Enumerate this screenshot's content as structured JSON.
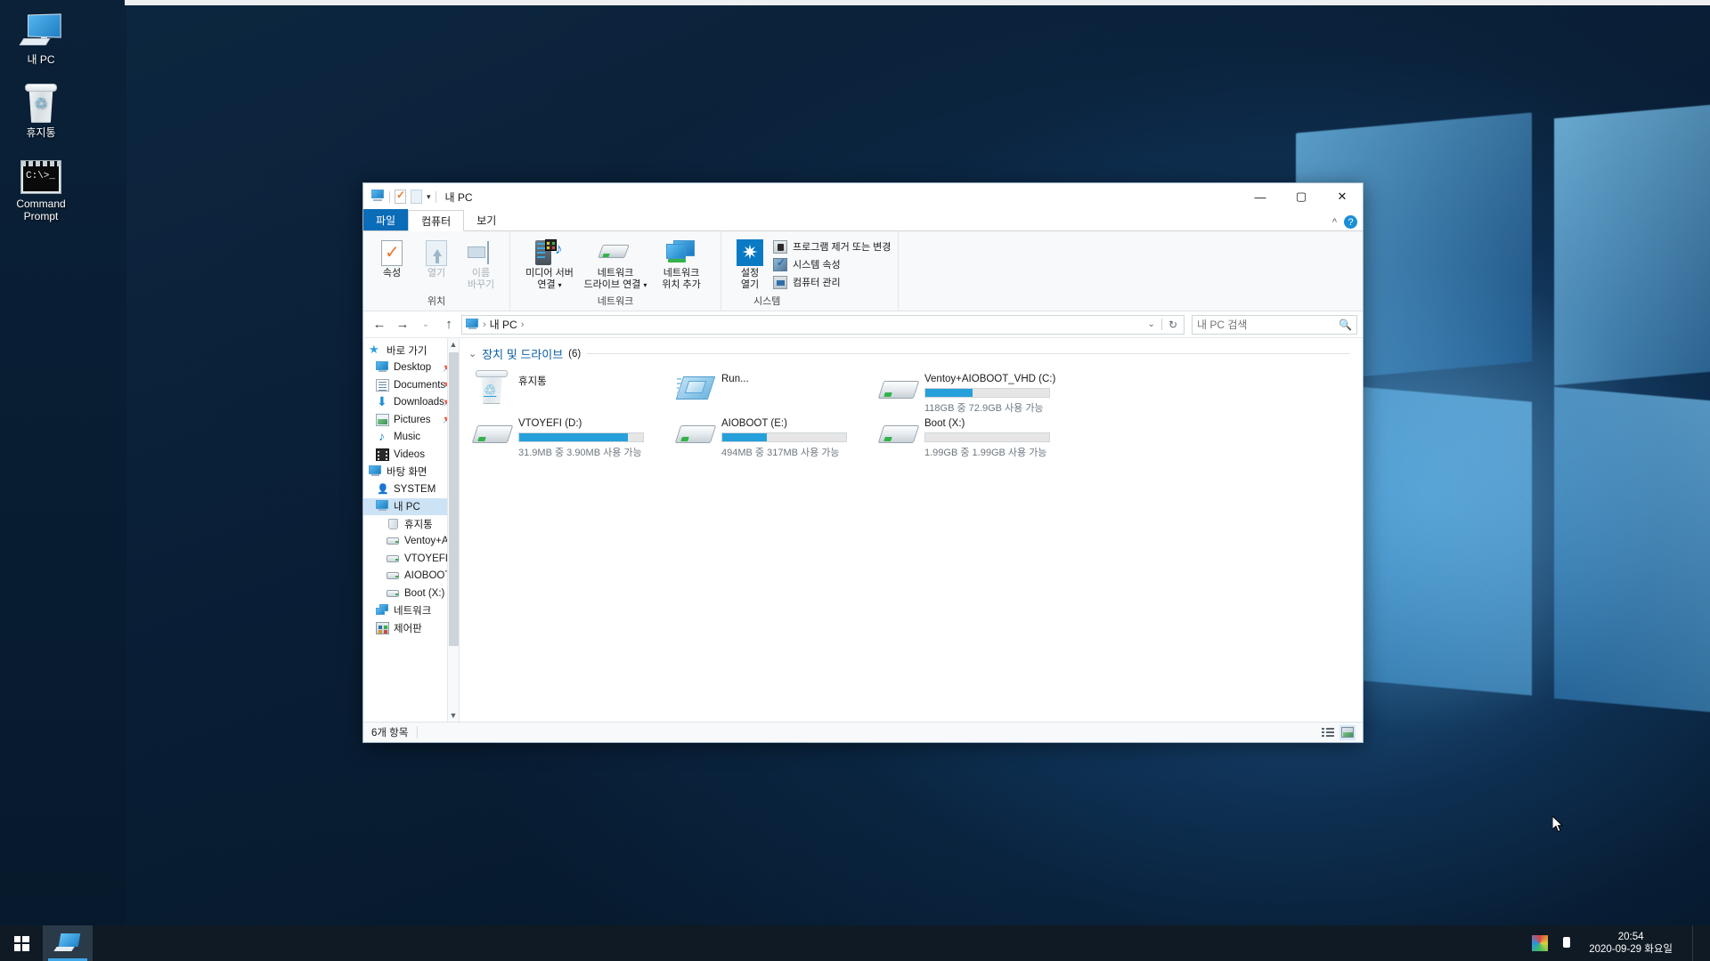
{
  "desktop": {
    "icons": [
      {
        "label": "내 PC",
        "icon": "monitor-icon"
      },
      {
        "label": "휴지통",
        "icon": "recycle-bin-icon"
      },
      {
        "label": "Command\nPrompt",
        "label_line1": "Command",
        "label_line2": "Prompt",
        "icon": "command-prompt-icon"
      }
    ]
  },
  "explorer": {
    "title": "내 PC",
    "quick_access_icons": [
      "monitor-icon",
      "properties-icon",
      "new-folder-icon",
      "customize-caret-icon"
    ],
    "window_controls": {
      "minimize": "—",
      "maximize": "▢",
      "close": "✕"
    },
    "tabs": [
      {
        "label": "파일",
        "active_file_menu": true
      },
      {
        "label": "컴퓨터",
        "selected": true
      },
      {
        "label": "보기",
        "selected": false
      }
    ],
    "ribbon": {
      "collapse_label": "^",
      "help_label": "?",
      "groups": [
        {
          "name": "위치",
          "buttons": [
            {
              "label": "속성",
              "icon": "properties-icon",
              "disabled": false
            },
            {
              "label": "열기",
              "icon": "open-icon",
              "disabled": true
            },
            {
              "label_line1": "이름",
              "label_line2": "바꾸기",
              "icon": "rename-icon",
              "disabled": true
            }
          ]
        },
        {
          "name": "네트워크",
          "buttons": [
            {
              "label_line1": "미디어 서버",
              "label_line2": "연결",
              "icon": "media-server-icon",
              "has_caret": true
            },
            {
              "label_line1": "네트워크",
              "label_line2": "드라이브 연결",
              "icon": "map-drive-icon",
              "has_caret": true
            },
            {
              "label_line1": "네트워크",
              "label_line2": "위치 추가",
              "icon": "add-network-location-icon",
              "has_caret": false
            }
          ]
        },
        {
          "name": "시스템",
          "big_button": {
            "label_line1": "설정",
            "label_line2": "열기",
            "icon": "settings-gear-icon"
          },
          "items": [
            {
              "label": "프로그램 제거 또는 변경",
              "icon": "uninstall-program-icon"
            },
            {
              "label": "시스템 속성",
              "icon": "system-properties-icon"
            },
            {
              "label": "컴퓨터 관리",
              "icon": "computer-management-icon"
            }
          ]
        }
      ]
    },
    "address": {
      "back": "←",
      "forward": "→",
      "recent": "⌄",
      "up": "↑",
      "crumbs": [
        "내 PC"
      ],
      "crumb_separator": "›",
      "history_caret": "⌄",
      "refresh": "↻"
    },
    "search": {
      "placeholder": "내 PC 검색",
      "value": "",
      "icon": "search-icon"
    },
    "sidebar": {
      "items": [
        {
          "label": "바로 가기",
          "icon": "quick-access-star-icon",
          "indent": 0,
          "pinned": false,
          "selected": false
        },
        {
          "label": "Desktop",
          "icon": "desktop-icon",
          "indent": 1,
          "pinned": true,
          "selected": false
        },
        {
          "label": "Documents",
          "icon": "documents-icon",
          "indent": 1,
          "pinned": true,
          "selected": false
        },
        {
          "label": "Downloads",
          "icon": "downloads-icon",
          "indent": 1,
          "pinned": true,
          "selected": false
        },
        {
          "label": "Pictures",
          "icon": "pictures-icon",
          "indent": 1,
          "pinned": true,
          "selected": false
        },
        {
          "label": "Music",
          "icon": "music-icon",
          "indent": 1,
          "pinned": false,
          "selected": false
        },
        {
          "label": "Videos",
          "icon": "videos-icon",
          "indent": 1,
          "pinned": false,
          "selected": false
        },
        {
          "label": "바탕 화면",
          "icon": "desktop-icon",
          "indent": 0,
          "pinned": false,
          "selected": false
        },
        {
          "label": "SYSTEM",
          "icon": "user-icon",
          "indent": 1,
          "pinned": false,
          "selected": false
        },
        {
          "label": "내 PC",
          "icon": "monitor-icon",
          "indent": 1,
          "pinned": false,
          "selected": true
        },
        {
          "label": "휴지통",
          "icon": "recycle-bin-icon",
          "indent": 2,
          "pinned": false,
          "selected": false
        },
        {
          "label": "Ventoy+AIOBO",
          "icon": "drive-icon",
          "indent": 2,
          "pinned": false,
          "selected": false
        },
        {
          "label": "VTOYEFI (D:)",
          "icon": "drive-icon",
          "indent": 2,
          "pinned": false,
          "selected": false
        },
        {
          "label": "AIOBOOT (E:)",
          "icon": "drive-icon",
          "indent": 2,
          "pinned": false,
          "selected": false
        },
        {
          "label": "Boot (X:)",
          "icon": "drive-icon",
          "indent": 2,
          "pinned": false,
          "selected": false
        },
        {
          "label": "네트워크",
          "icon": "network-icon",
          "indent": 1,
          "pinned": false,
          "selected": false
        },
        {
          "label": "제어판",
          "icon": "control-panel-icon",
          "indent": 1,
          "pinned": false,
          "selected": false
        }
      ]
    },
    "content": {
      "group_title": "장치 및 드라이브",
      "group_count": "(6)",
      "items": [
        {
          "name": "휴지통",
          "icon": "recycle-bin-icon",
          "has_bar": false
        },
        {
          "name": "Run...",
          "icon": "run-icon",
          "has_bar": false
        },
        {
          "name": "Ventoy+AIOBOOT_VHD (C:)",
          "icon": "drive-icon",
          "has_bar": true,
          "fill_percent": 38,
          "sub": "118GB 중 72.9GB 사용 가능"
        },
        {
          "name": "VTOYEFI (D:)",
          "icon": "drive-icon",
          "has_bar": true,
          "fill_percent": 88,
          "sub": "31.9MB 중 3.90MB 사용 가능"
        },
        {
          "name": "AIOBOOT (E:)",
          "icon": "drive-icon",
          "has_bar": true,
          "fill_percent": 36,
          "sub": "494MB 중 317MB 사용 가능"
        },
        {
          "name": "Boot (X:)",
          "icon": "drive-icon",
          "has_bar": true,
          "fill_percent": 0,
          "sub": "1.99GB 중 1.99GB 사용 가능"
        }
      ]
    },
    "status": {
      "item_count": "6개 항목",
      "view_details_icon": "details-view-icon",
      "view_icons_icon": "large-icons-view-icon"
    }
  },
  "taskbar": {
    "start_icon": "windows-start-icon",
    "tasks": [
      {
        "label": "파일 탐색기",
        "icon": "file-explorer-icon",
        "active": true
      }
    ],
    "tray": [
      {
        "icon": "color-profile-icon"
      },
      {
        "icon": "usb-eject-icon"
      }
    ],
    "clock": {
      "time": "20:54",
      "date": "2020-09-29 화요일"
    }
  },
  "colors": {
    "accent_blue": "#0b6cb8",
    "progress_blue": "#26a0da",
    "selection_blue": "#cce3f5",
    "taskbar": "#101a24"
  }
}
